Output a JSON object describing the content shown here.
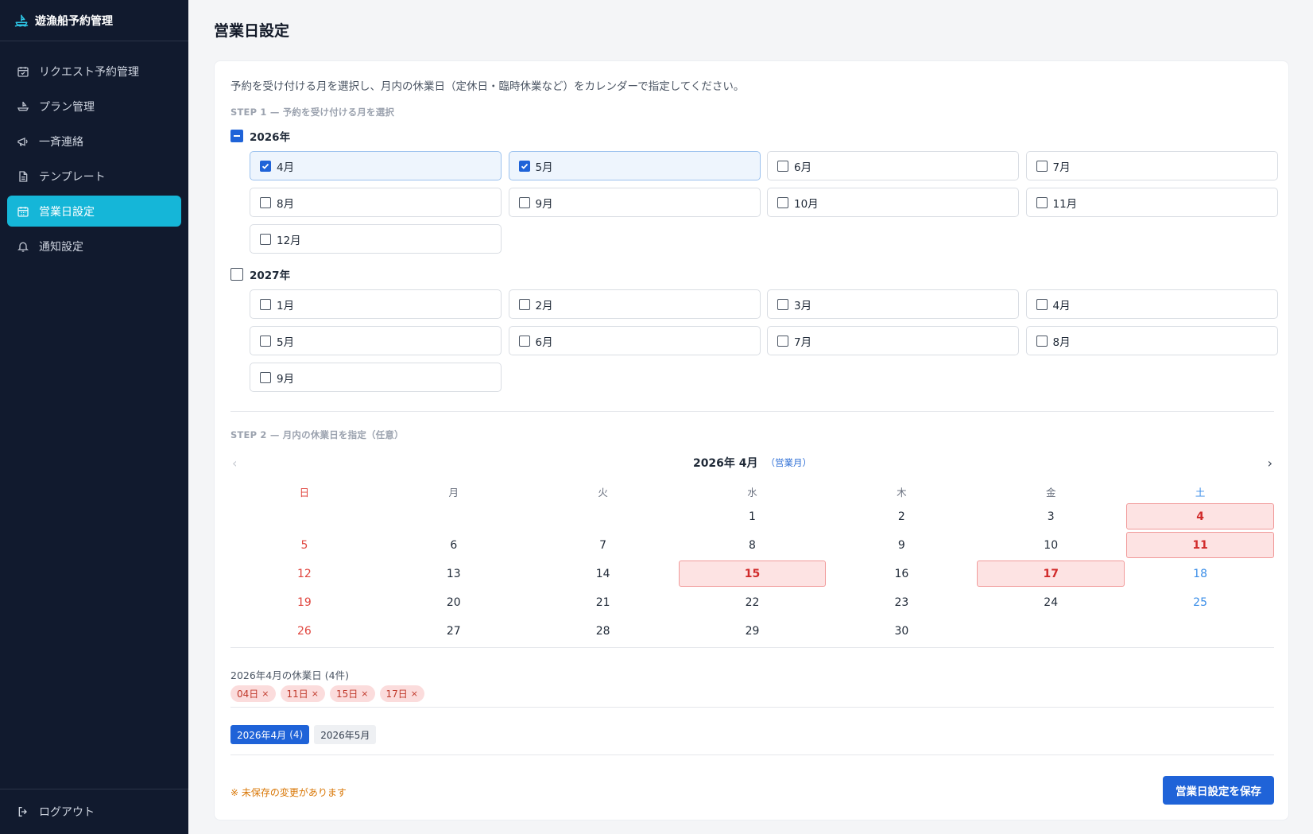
{
  "app": {
    "title": "遊漁船予約管理"
  },
  "sidebar": {
    "items": [
      {
        "label": "リクエスト予約管理",
        "icon": "calendar-check-icon",
        "active": false
      },
      {
        "label": "プラン管理",
        "icon": "ship-icon",
        "active": false
      },
      {
        "label": "一斉連絡",
        "icon": "megaphone-icon",
        "active": false
      },
      {
        "label": "テンプレート",
        "icon": "document-icon",
        "active": false
      },
      {
        "label": "営業日設定",
        "icon": "calendar-icon",
        "active": true
      },
      {
        "label": "通知設定",
        "icon": "bell-icon",
        "active": false
      }
    ],
    "logout_label": "ログアウト"
  },
  "page": {
    "title": "営業日設定",
    "description": "予約を受け付ける月を選択し、月内の休業日（定休日・臨時休業など）をカレンダーで指定してください。",
    "step1_label": "STEP 1 — 予約を受け付ける月を選択",
    "step2_label": "STEP 2 — 月内の休業日を指定（任意）"
  },
  "years": [
    {
      "label": "2026年",
      "state": "indeterminate",
      "months": [
        {
          "label": "4月",
          "checked": true
        },
        {
          "label": "5月",
          "checked": true
        },
        {
          "label": "6月",
          "checked": false
        },
        {
          "label": "7月",
          "checked": false
        },
        {
          "label": "8月",
          "checked": false
        },
        {
          "label": "9月",
          "checked": false
        },
        {
          "label": "10月",
          "checked": false
        },
        {
          "label": "11月",
          "checked": false
        },
        {
          "label": "12月",
          "checked": false
        }
      ]
    },
    {
      "label": "2027年",
      "state": "unchecked",
      "months": [
        {
          "label": "1月",
          "checked": false
        },
        {
          "label": "2月",
          "checked": false
        },
        {
          "label": "3月",
          "checked": false
        },
        {
          "label": "4月",
          "checked": false
        },
        {
          "label": "5月",
          "checked": false
        },
        {
          "label": "6月",
          "checked": false
        },
        {
          "label": "7月",
          "checked": false
        },
        {
          "label": "8月",
          "checked": false
        },
        {
          "label": "9月",
          "checked": false
        }
      ]
    }
  ],
  "calendar": {
    "title": "2026年 4月",
    "badge": "（営業月）",
    "prev": "‹",
    "next": "›",
    "weekdays": [
      "日",
      "月",
      "火",
      "水",
      "木",
      "金",
      "土"
    ],
    "leading_blanks": 3,
    "days_in_month": 30,
    "holidays": [
      4,
      11,
      15,
      17
    ]
  },
  "holiday_summary": "2026年4月の休業日 (4件)",
  "holiday_chips": [
    "04日",
    "11日",
    "15日",
    "17日"
  ],
  "month_tabs": [
    {
      "label": "2026年4月",
      "count": "(4)",
      "active": true
    },
    {
      "label": "2026年5月",
      "count": "",
      "active": false
    }
  ],
  "unsaved_notice": "※ 未保存の変更があります",
  "save_button": "営業日設定を保存",
  "colors": {
    "sidebar_bg": "#111a2e",
    "active_nav": "#15b6d8",
    "primary": "#1f63d8",
    "holiday_bg": "#fde3e3",
    "holiday_text": "#d12b2b",
    "sunday": "#e0463f",
    "saturday": "#3b8ee8",
    "warning": "#d97706"
  }
}
